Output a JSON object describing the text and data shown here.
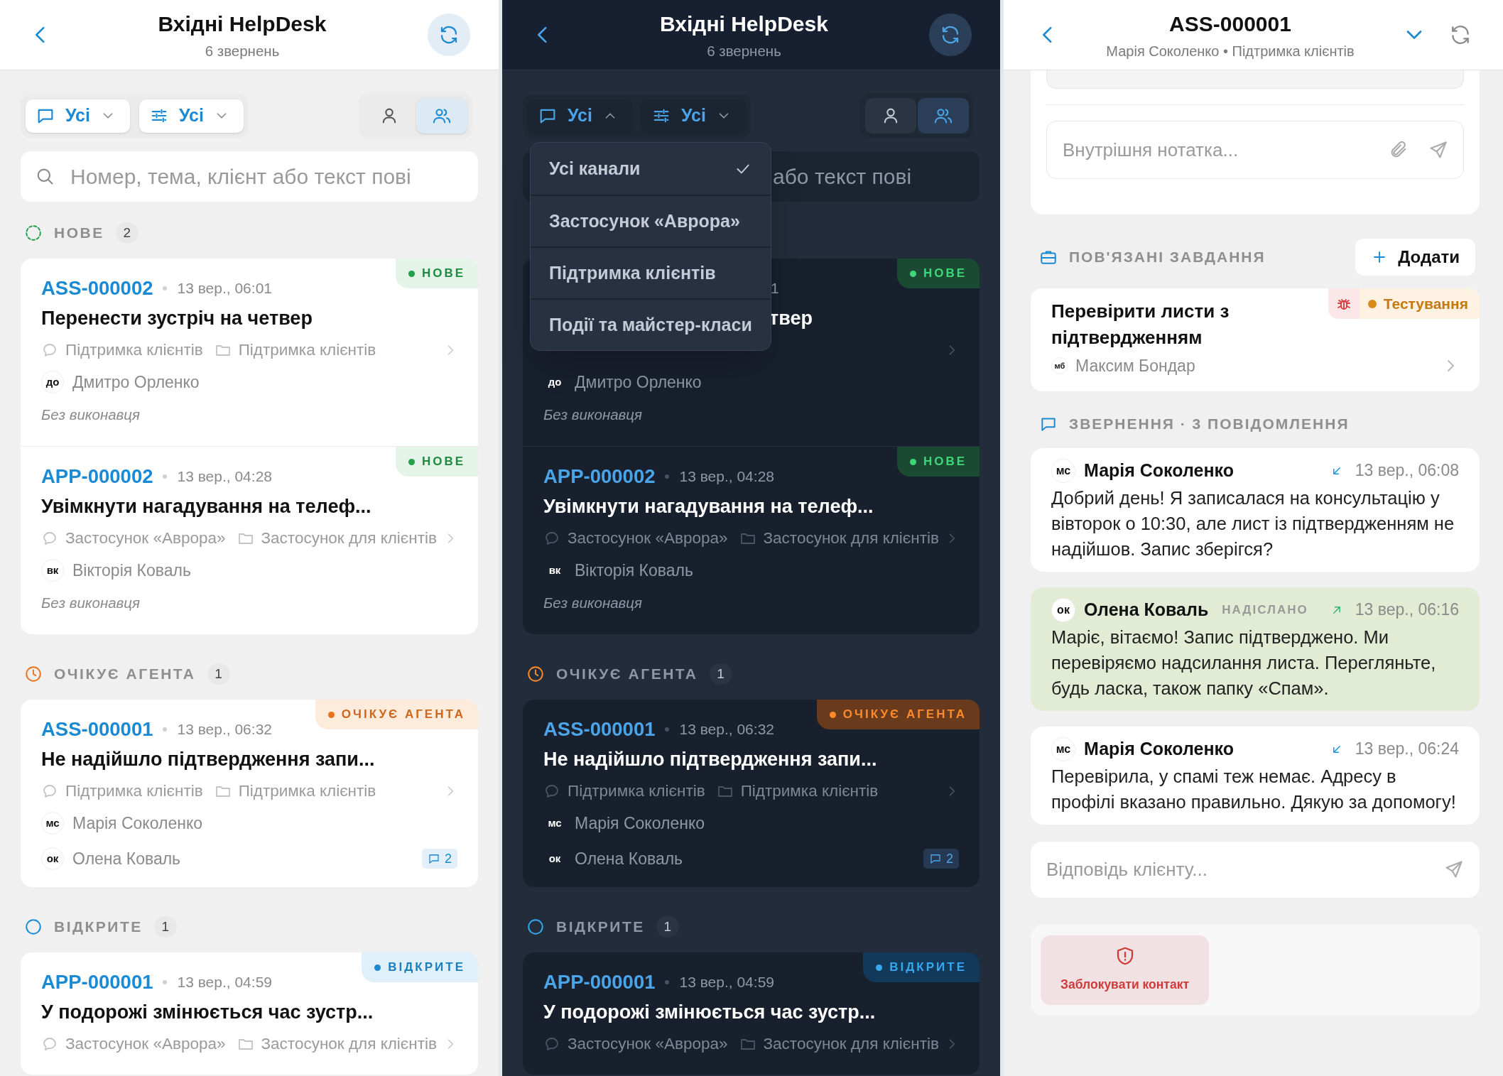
{
  "screens": [
    {
      "kind": "light-list",
      "title": "Вхідні HelpDesk",
      "subtitle": "6 звернень",
      "filters": [
        {
          "kind": "channel",
          "label": "Усі",
          "expanded": false
        },
        {
          "kind": "status",
          "label": "Усі",
          "expanded": false
        }
      ],
      "scope": [
        {
          "kind": "me",
          "selected": false
        },
        {
          "kind": "all",
          "selected": true
        }
      ],
      "search": {
        "placeholder": "Номер, тема, клієнт або текст пові",
        "covered": false
      },
      "groups": [
        {
          "kind": "new",
          "label": "НОВЕ",
          "count": "2",
          "tickets": [
            {
              "covered": false,
              "id": "ASS-000002",
              "date": "13 вер., 06:01",
              "badge": "НОВЕ",
              "title": "Перенести зустріч на четвер",
              "channel": "Підтримка клієнтів",
              "folder": "Підтримка клієнтів",
              "client": {
                "initials": "до",
                "name": "Дмитро Орленко"
              },
              "unassigned": "Без виконавця"
            },
            {
              "covered": false,
              "id": "APP-000002",
              "date": "13 вер., 04:28",
              "badge": "НОВЕ",
              "title": "Увімкнути нагадування на телеф...",
              "channel": "Застосунок «Аврора»",
              "folder": "Застосунок для клієнтів",
              "client": {
                "initials": "вк",
                "name": "Вікторія Коваль"
              },
              "unassigned": "Без виконавця"
            }
          ]
        },
        {
          "kind": "waiting",
          "label": "ОЧІКУЄ АГЕНТА",
          "count": "1",
          "tickets": [
            {
              "covered": false,
              "id": "ASS-000001",
              "date": "13 вер., 06:32",
              "badge": "ОЧІКУЄ АГЕНТА",
              "title": "Не надійшло підтвердження запи...",
              "channel": "Підтримка клієнтів",
              "folder": "Підтримка клієнтів",
              "client": {
                "initials": "мс",
                "name": "Марія Соколенко"
              },
              "assignee": {
                "initials": "ок",
                "name": "Олена Коваль"
              },
              "comments": "2"
            }
          ]
        },
        {
          "kind": "open",
          "label": "ВІДКРИТЕ",
          "count": "1",
          "tickets": [
            {
              "covered": false,
              "id": "APP-000001",
              "date": "13 вер., 04:59",
              "badge": "ВІДКРИТЕ",
              "title": "У подорожі змінюється час зустр...",
              "channel": "Застосунок «Аврора»",
              "folder": "Застосунок для клієнтів"
            }
          ]
        }
      ]
    },
    {
      "kind": "dark-list",
      "title": "Вхідні HelpDesk",
      "subtitle": "6 звернень",
      "filters": [
        {
          "kind": "channel",
          "label": "Усі",
          "expanded": true
        },
        {
          "kind": "status",
          "label": "Усі",
          "expanded": false
        }
      ],
      "scope": [
        {
          "kind": "me",
          "selected": false
        },
        {
          "kind": "all",
          "selected": true
        }
      ],
      "search": {
        "placeholder": "або текст пові",
        "covered": true
      },
      "dropdown": {
        "items": [
          {
            "label": "Усі канали",
            "selected": true
          },
          {
            "label": "Застосунок «Аврора»",
            "selected": false
          },
          {
            "label": "Підтримка клієнтів",
            "selected": false
          },
          {
            "label": "Події та майстер-класи",
            "selected": false
          }
        ]
      },
      "groups": [
        {
          "kind": "new",
          "tickets": [
            {
              "covered": true,
              "date": "1",
              "badge": "НОВЕ",
              "title": "твер",
              "client": {
                "initials": "до",
                "name": "Дмитро Орленко"
              },
              "unassigned": "Без виконавця"
            },
            {
              "covered": false,
              "id": "APP-000002",
              "date": "13 вер., 04:28",
              "badge": "НОВЕ",
              "title": "Увімкнути нагадування на телеф...",
              "channel": "Застосунок «Аврора»",
              "folder": "Застосунок для клієнтів",
              "client": {
                "initials": "вк",
                "name": "Вікторія Коваль"
              },
              "unassigned": "Без виконавця"
            }
          ]
        },
        {
          "kind": "waiting",
          "label": "ОЧІКУЄ АГЕНТА",
          "count": "1",
          "tickets": [
            {
              "covered": false,
              "id": "ASS-000001",
              "date": "13 вер., 06:32",
              "badge": "ОЧІКУЄ АГЕНТА",
              "title": "Не надійшло підтвердження запи...",
              "channel": "Підтримка клієнтів",
              "folder": "Підтримка клієнтів",
              "client": {
                "initials": "мс",
                "name": "Марія Соколенко"
              },
              "assignee": {
                "initials": "ок",
                "name": "Олена Коваль"
              },
              "comments": "2"
            }
          ]
        },
        {
          "kind": "open",
          "label": "ВІДКРИТЕ",
          "count": "1",
          "tickets": [
            {
              "covered": false,
              "id": "APP-000001",
              "date": "13 вер., 04:59",
              "badge": "ВІДКРИТЕ",
              "title": "У подорожі змінюється час зустр...",
              "channel": "Застосунок «Аврора»",
              "folder": "Застосунок для клієнтів"
            }
          ]
        }
      ]
    },
    {
      "kind": "detail",
      "title": "ASS-000001",
      "subtitle": "Марія Соколенко • Підтримка клієнтів",
      "note": {
        "placeholder": "Внутрішня нотатка..."
      },
      "tasks": {
        "label": "ПОВ'ЯЗАНІ ЗАВДАННЯ",
        "add": "Додати",
        "items": [
          {
            "kind": "bug",
            "title": "Перевірити листи з підтвердженням",
            "status": "Тестування",
            "assignee": {
              "initials": "мб",
              "name": "Максим Бондар"
            }
          }
        ]
      },
      "thread": {
        "label": "ЗВЕРНЕННЯ · 3 ПОВІДОМЛЕННЯ",
        "messages": [
          {
            "kind": "incoming",
            "initials": "мс",
            "author": "Марія Соколенко",
            "time": "13 вер., 06:08",
            "text": "Добрий день! Я записалася на консультацію у вівторок о 10:30, але лист із підтвердженням не надійшов. Запис зберігся?"
          },
          {
            "kind": "outgoing",
            "initials": "ок",
            "author": "Олена Коваль",
            "state": "НАДІСЛАНО",
            "time": "13 вер., 06:16",
            "text": "Маріє, вітаємо! Запис підтверджено. Ми перевіряємо надсилання листа. Перегляньте, будь ласка, також папку «Спам»."
          },
          {
            "kind": "incoming",
            "initials": "мс",
            "author": "Марія Соколенко",
            "time": "13 вер., 06:24",
            "text": "Перевірила, у спамі теж немає. Адресу в профілі вказано правильно. Дякую за допомогу!"
          }
        ]
      },
      "reply": {
        "placeholder": "Відповідь клієнту..."
      },
      "block": "Заблокувати контакт"
    }
  ]
}
